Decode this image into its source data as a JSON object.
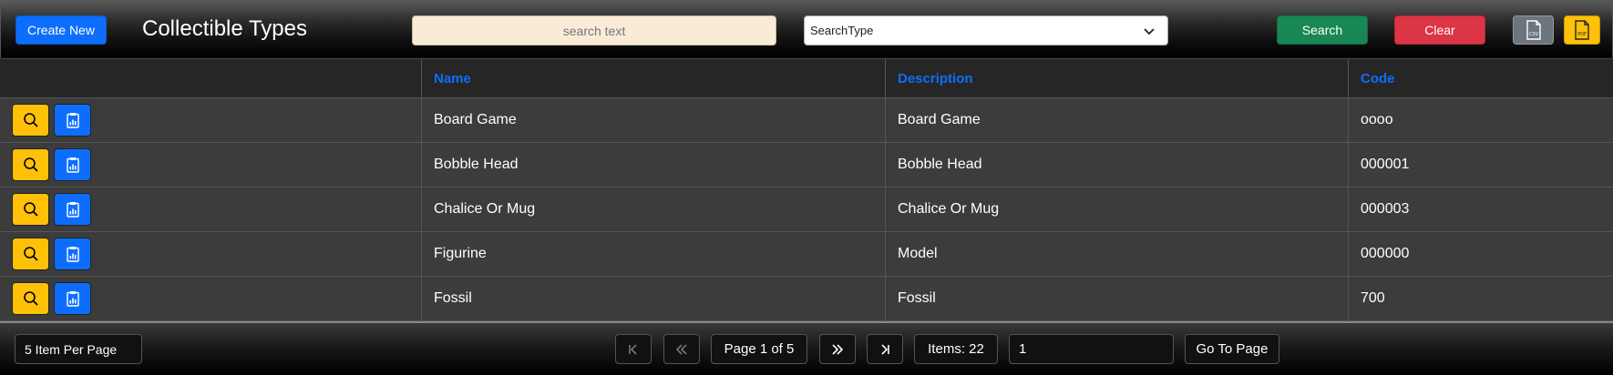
{
  "toolbar": {
    "create_label": "Create New",
    "title": "Collectible Types",
    "search_placeholder": "search text",
    "search_value": "",
    "search_type_selected": "SearchType",
    "search_label": "Search",
    "clear_label": "Clear",
    "csv_icon": "csv-file-icon",
    "pdf_icon": "pdf-file-icon"
  },
  "table": {
    "columns": [
      "",
      "Name",
      "Description",
      "Code"
    ],
    "rows": [
      {
        "name": "Board Game",
        "description": "Board Game",
        "code": "oooo"
      },
      {
        "name": "Bobble Head",
        "description": "Bobble Head",
        "code": "000001"
      },
      {
        "name": "Chalice Or Mug",
        "description": "Chalice Or Mug",
        "code": "000003"
      },
      {
        "name": "Figurine",
        "description": "Model",
        "code": "000000"
      },
      {
        "name": "Fossil",
        "description": "Fossil",
        "code": "700"
      }
    ],
    "row_actions": [
      "search-icon",
      "report-icon"
    ]
  },
  "pagination": {
    "per_page_label": "5 Item Per Page",
    "page_info": "Page 1 of 5",
    "items_label": "Items: 22",
    "goto_value": "1",
    "goto_label": "Go To Page"
  },
  "colors": {
    "primary": "#0d6efd",
    "success": "#198754",
    "danger": "#dc3545",
    "warning": "#ffc107",
    "secondary": "#6c757d",
    "search_bg": "#faebd7"
  }
}
